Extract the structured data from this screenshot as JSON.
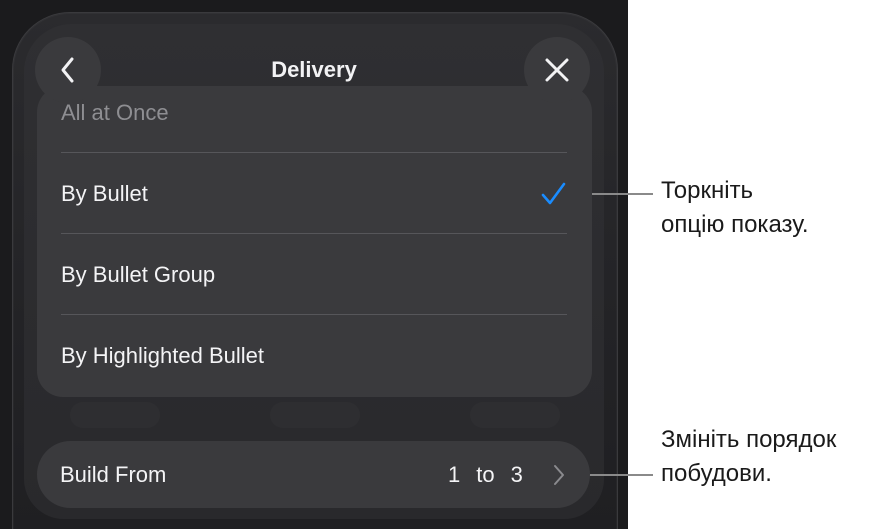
{
  "sheet": {
    "title": "Delivery",
    "back_icon": "chevron-left-icon",
    "close_icon": "close-icon"
  },
  "delivery_options": [
    {
      "label": "All at Once",
      "selected": false
    },
    {
      "label": "By Bullet",
      "selected": true
    },
    {
      "label": "By Bullet Group",
      "selected": false
    },
    {
      "label": "By Highlighted Bullet",
      "selected": false
    }
  ],
  "build_from": {
    "label": "Build From",
    "start": "1",
    "separator": "to",
    "end": "3",
    "chevron_icon": "chevron-right-icon"
  },
  "callouts": {
    "option": {
      "line1": "Торкніть",
      "line2": "опцію показу."
    },
    "order": {
      "line1": "Змініть порядок",
      "line2": "побудови."
    }
  },
  "colors": {
    "checkmark": "#1a8cff",
    "panel": "#3a3a3d",
    "background": "#1b1b1d"
  }
}
